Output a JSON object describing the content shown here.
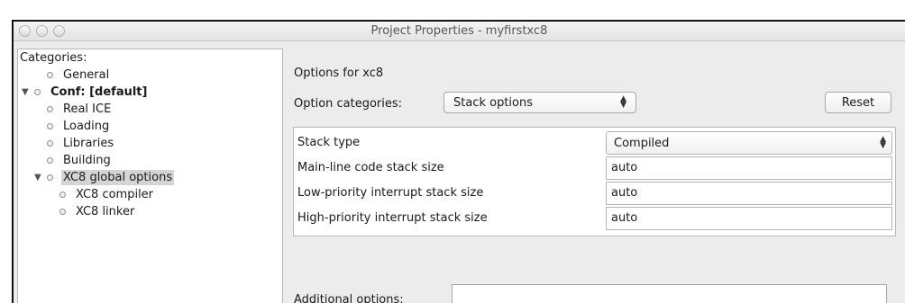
{
  "window": {
    "title": "Project Properties - myfirstxc8"
  },
  "categories": {
    "label": "Categories:",
    "items": [
      {
        "label": "General"
      },
      {
        "label": "Conf: [default]"
      },
      {
        "label": "Real ICE"
      },
      {
        "label": "Loading"
      },
      {
        "label": "Libraries"
      },
      {
        "label": "Building"
      },
      {
        "label": "XC8 global options"
      },
      {
        "label": "XC8 compiler"
      },
      {
        "label": "XC8 linker"
      }
    ]
  },
  "options": {
    "heading": "Options for xc8",
    "category_label": "Option categories:",
    "category_value": "Stack options",
    "reset_label": "Reset",
    "rows": [
      {
        "name": "Stack type",
        "value": "Compiled"
      },
      {
        "name": "Main-line code stack size",
        "value": "auto"
      },
      {
        "name": "Low-priority interrupt stack size",
        "value": "auto"
      },
      {
        "name": "High-priority interrupt stack size",
        "value": "auto"
      }
    ],
    "additional_label": "Additional options:",
    "additional_value": ""
  }
}
